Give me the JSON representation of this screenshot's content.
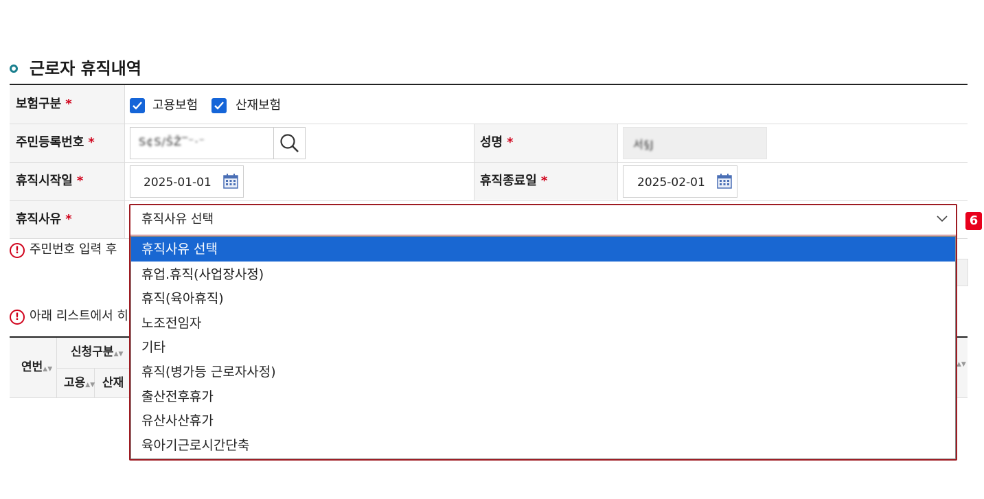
{
  "section": {
    "title": "근로자 휴직내역"
  },
  "form": {
    "required_mark": "*",
    "insurance": {
      "label": "보험구분",
      "options": [
        {
          "label": "고용보험",
          "checked": true
        },
        {
          "label": "산재보험",
          "checked": true
        }
      ]
    },
    "resident_no": {
      "label": "주민등록번호",
      "value": "S¢S/ŠŽ‾⁻·⁻"
    },
    "name": {
      "label": "성명",
      "value": "서§J"
    },
    "leave_start": {
      "label": "휴직시작일",
      "value": "2025-01-01"
    },
    "leave_end": {
      "label": "휴직종료일",
      "value": "2025-02-01"
    },
    "leave_reason": {
      "label": "휴직사유",
      "selected": "휴직사유 선택"
    }
  },
  "notices": [
    "주민번호 입력 후",
    "아래 리스트에서 히"
  ],
  "grid": {
    "headers": {
      "no": "연번",
      "apply_type": "신청구분",
      "employment": "고용",
      "industrial": "산재"
    }
  },
  "dropdown": {
    "options": [
      "휴직사유 선택",
      "휴업.휴직(사업장사정)",
      "휴직(육아휴직)",
      "노조전임자",
      "기타",
      "휴직(병가등 근로자사정)",
      "출산전후휴가",
      "유산사산휴가",
      "육아기근로시간단축"
    ],
    "selected_index": 0
  },
  "step_badge": "6",
  "colors": {
    "accent": "#1967d2",
    "required": "#d0021b",
    "highlight_border": "#9e1b22",
    "badge": "#e8001c"
  }
}
